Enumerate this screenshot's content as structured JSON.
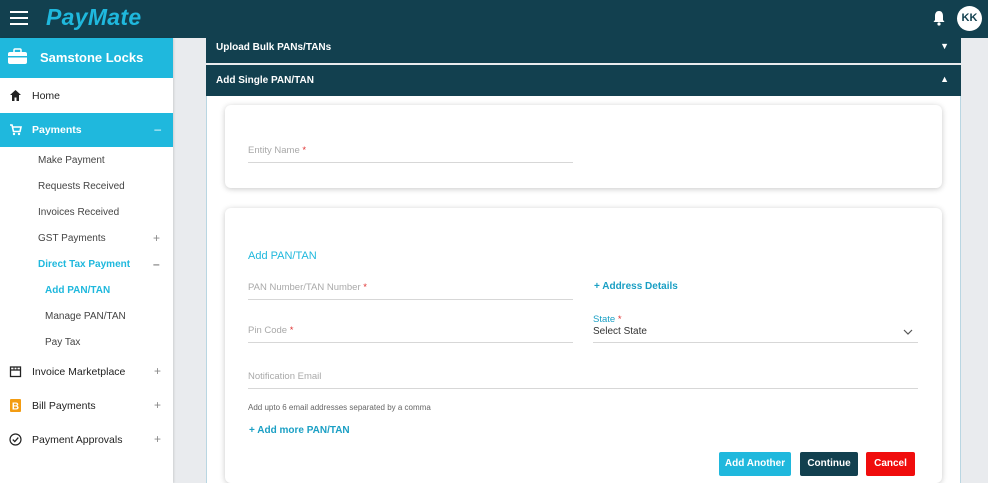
{
  "header": {
    "logo": "PayMate",
    "avatar_initials": "KK"
  },
  "sidebar": {
    "company": "Samstone Locks",
    "items": [
      {
        "label": "Home",
        "icon": "home-icon"
      },
      {
        "label": "Payments",
        "icon": "cart-icon",
        "toggle": "–"
      },
      {
        "label": "Invoice Marketplace",
        "icon": "store-icon",
        "toggle": "+"
      },
      {
        "label": "Bill Payments",
        "icon": "bill-icon",
        "toggle": "+"
      },
      {
        "label": "Payment Approvals",
        "icon": "check-circle-icon",
        "toggle": "+"
      }
    ],
    "payments_sub": [
      {
        "label": "Make Payment"
      },
      {
        "label": "Requests Received"
      },
      {
        "label": "Invoices Received"
      },
      {
        "label": "GST Payments",
        "toggle": "+"
      },
      {
        "label": "Direct Tax Payment",
        "toggle": "–"
      }
    ],
    "direct_tax_sub": [
      {
        "label": "Add PAN/TAN"
      },
      {
        "label": "Manage PAN/TAN"
      },
      {
        "label": "Pay Tax"
      }
    ]
  },
  "main": {
    "accordion_bulk": "Upload Bulk PANs/TANs",
    "accordion_single": "Add Single PAN/TAN",
    "entity_name_placeholder": "Entity Name",
    "required_mark": "*",
    "section_title": "Add PAN/TAN",
    "pan_placeholder": "PAN Number/TAN Number",
    "address_link": "+ Address Details",
    "pincode_placeholder": "Pin Code",
    "state_label": "State",
    "state_value": "Select State",
    "email_placeholder": "Notification Email",
    "email_hint": "Add upto 6 email addresses separated by a comma",
    "add_more": "+ Add more PAN/TAN",
    "buttons": {
      "add_another": "Add Another",
      "continue": "Continue",
      "cancel": "Cancel"
    }
  },
  "colors": {
    "primary_dark": "#12404f",
    "accent": "#1fb8dd",
    "danger": "#f00d0d"
  }
}
